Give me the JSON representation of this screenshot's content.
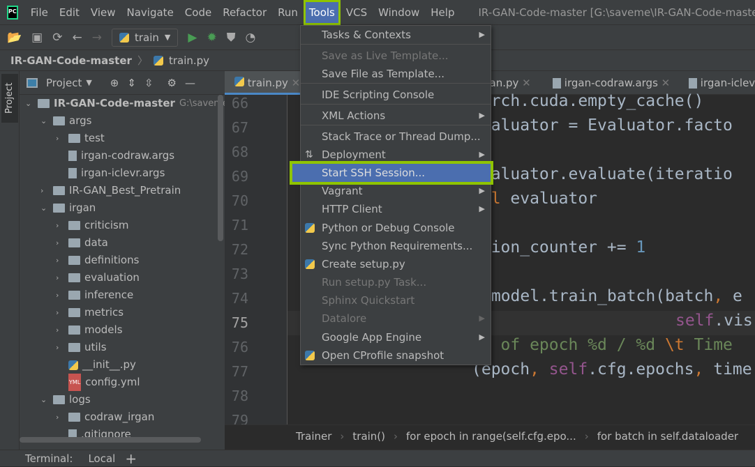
{
  "menubar": {
    "items": [
      "File",
      "Edit",
      "View",
      "Navigate",
      "Code",
      "Refactor",
      "Run",
      "Tools",
      "VCS",
      "Window",
      "Help"
    ],
    "active": "Tools",
    "window_title": "IR-GAN-Code-master [G:\\saveme\\IR-GAN-Code-master"
  },
  "toolbar": {
    "run_config": "train"
  },
  "breadcrumb": {
    "project": "IR-GAN-Code-master",
    "file": "train.py"
  },
  "left_strip": {
    "project_label": "Project"
  },
  "project_panel": {
    "title": "Project",
    "tree": [
      {
        "label": "IR-GAN-Code-master",
        "path": "G:\\saveme",
        "type": "folder",
        "open": true,
        "level": 0
      },
      {
        "label": "args",
        "type": "folder",
        "open": true,
        "level": 1
      },
      {
        "label": "test",
        "type": "folder",
        "open": false,
        "level": 2
      },
      {
        "label": "irgan-codraw.args",
        "type": "file",
        "level": 2
      },
      {
        "label": "irgan-iclevr.args",
        "type": "file",
        "level": 2
      },
      {
        "label": "IR-GAN_Best_Pretrain",
        "type": "folder",
        "open": false,
        "level": 1
      },
      {
        "label": "irgan",
        "type": "folder",
        "open": true,
        "level": 1
      },
      {
        "label": "criticism",
        "type": "folder",
        "open": false,
        "level": 2
      },
      {
        "label": "data",
        "type": "folder",
        "open": false,
        "level": 2
      },
      {
        "label": "definitions",
        "type": "folder",
        "open": false,
        "level": 2
      },
      {
        "label": "evaluation",
        "type": "folder",
        "open": false,
        "level": 2
      },
      {
        "label": "inference",
        "type": "folder",
        "open": false,
        "level": 2
      },
      {
        "label": "metrics",
        "type": "folder",
        "open": false,
        "level": 2
      },
      {
        "label": "models",
        "type": "folder",
        "open": false,
        "level": 2
      },
      {
        "label": "utils",
        "type": "folder",
        "open": false,
        "level": 2
      },
      {
        "label": "__init__.py",
        "type": "pyfile",
        "level": 2
      },
      {
        "label": "config.yml",
        "type": "yml",
        "level": 2
      },
      {
        "label": "logs",
        "type": "folder",
        "open": true,
        "level": 1
      },
      {
        "label": "codraw_irgan",
        "type": "folder",
        "open": false,
        "level": 2
      },
      {
        "label": ".gitignore",
        "type": "file",
        "level": 2
      }
    ]
  },
  "editor": {
    "tabs": [
      "train.py",
      "gan.py",
      "irgan-codraw.args",
      "irgan-iclev"
    ],
    "line_numbers": [
      "66",
      "67",
      "68",
      "69",
      "70",
      "71",
      "72",
      "73",
      "74",
      "75",
      "76",
      "77",
      "78",
      "79"
    ],
    "current_line": "75",
    "code": {
      "l66": "torch.cuda.empty_cache()",
      "l67": "evaluator = Evaluator.facto",
      "l69": "evaluator.evaluate(iteratio",
      "l70_kw": "del",
      "l70": " evaluator",
      "l72": "ation_counter += ",
      "l72_num": "1",
      "l74": ".model.train_batch(batch",
      "l74_b": ", ",
      "l74_c": "e",
      "l75_self": "self",
      "l75": ".vis",
      "l76_a": "nd of epoch %d / %d ",
      "l76_b": "\\t",
      "l76_c": " Time",
      "l77_a": "(epoch",
      "l77_b": ", ",
      "l77_self": "self",
      "l77_c": ".cfg.epochs",
      "l77_d": ", ",
      "l77_e": "time"
    },
    "breadcrumb": [
      "Trainer",
      "train()",
      "for epoch in range(self.cfg.epo...",
      "for batch in self.dataloader"
    ]
  },
  "tools_menu": {
    "items": [
      {
        "label": "Tasks & Contexts",
        "submenu": true
      },
      {
        "label": "Save as Live Template...",
        "disabled": true
      },
      {
        "label": "Save File as Template..."
      },
      {
        "label": "IDE Scripting Console"
      },
      {
        "label": "XML Actions",
        "submenu": true
      },
      {
        "label": "Stack Trace or Thread Dump..."
      },
      {
        "label": "Deployment",
        "submenu": true,
        "icon": "deployment-icon"
      },
      {
        "label": "Start SSH Session...",
        "selected": true
      },
      {
        "label": "Vagrant",
        "submenu": true
      },
      {
        "label": "HTTP Client",
        "submenu": true
      },
      {
        "label": "Python or Debug Console",
        "icon": "python-console-icon"
      },
      {
        "label": "Sync Python Requirements..."
      },
      {
        "label": "Create setup.py",
        "icon": "python-file-icon"
      },
      {
        "label": "Run setup.py Task...",
        "disabled": true
      },
      {
        "label": "Sphinx Quickstart",
        "disabled": true
      },
      {
        "label": "Datalore",
        "submenu": true,
        "disabled": true
      },
      {
        "label": "Google App Engine",
        "submenu": true
      },
      {
        "label": "Open CProfile snapshot",
        "icon": "cprofile-icon"
      }
    ]
  },
  "terminal_bar": {
    "label": "Terminal:",
    "tab": "Local",
    "add": "+"
  },
  "colors": {
    "highlight": "#8fc400",
    "selection": "#4b6eaf",
    "background": "#2b2b2b",
    "panel": "#3c3f41"
  }
}
